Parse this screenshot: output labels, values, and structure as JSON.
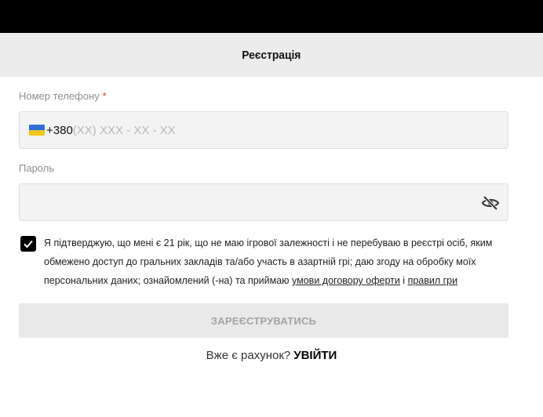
{
  "header": {
    "title": "Реєстрація"
  },
  "phone": {
    "label": "Номер телефону",
    "required_mark": "*",
    "country_code": "+380",
    "placeholder": "(XX) XXX - XX - XX",
    "flag_icon": "ukraine-flag-icon"
  },
  "password": {
    "label": "Пароль",
    "value": "",
    "toggle_icon": "eye-off-icon"
  },
  "consent": {
    "checked": true,
    "text": "Я підтверджую, що мені є 21 рік, що не маю ігрової залежності і не перебуваю в реєстрі осіб, яким обмежено доступ до гральних закладів та/або участь в азартній грі; даю згоду на обробку моїх персональних даних; ознайомлений (-на) та приймаю ",
    "terms_link": "умови договору оферти",
    "separator": " і ",
    "rules_link": "правил гри"
  },
  "submit": {
    "label": "ЗАРЕЄСТРУВАТИСЬ"
  },
  "login": {
    "prompt": "Вже є рахунок?",
    "link": "УВІЙТИ"
  },
  "colors": {
    "topbar": "#000000",
    "header_bg": "#ececec",
    "field_bg": "#f3f3f3",
    "required": "#e53935",
    "button_disabled_bg": "#e9e9e9",
    "button_disabled_text": "#a3a3a3"
  }
}
